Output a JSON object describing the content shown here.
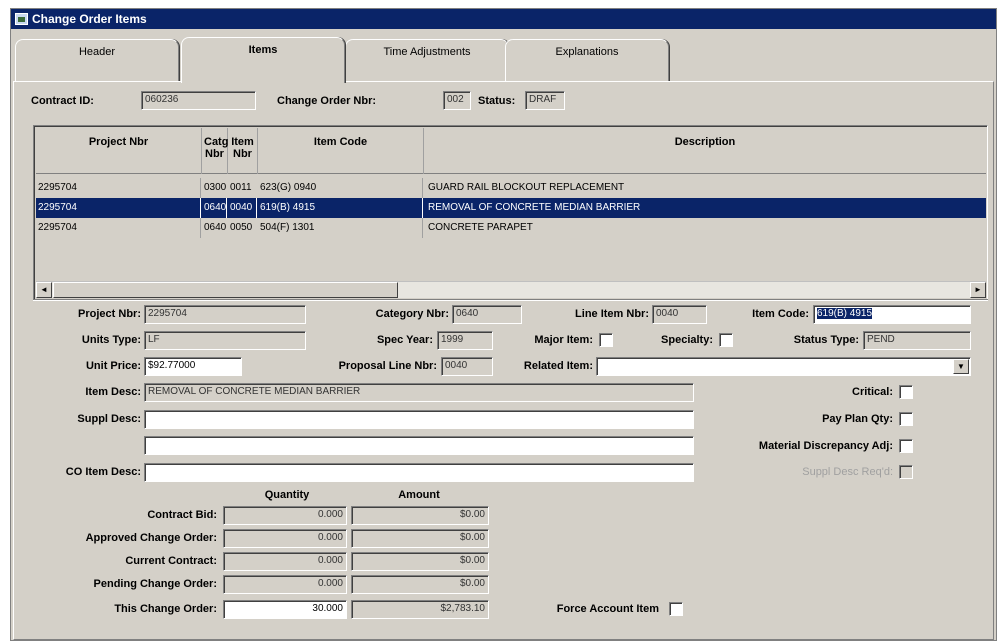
{
  "window": {
    "title": "Change Order Items"
  },
  "tabs": [
    {
      "label": "Header"
    },
    {
      "label": "Items"
    },
    {
      "label": "Time Adjustments"
    },
    {
      "label": "Explanations"
    }
  ],
  "header_info": {
    "contract_id_label": "Contract ID:",
    "contract_id": "060236",
    "change_order_label": "Change Order Nbr:",
    "change_order": "002",
    "status_label": "Status:",
    "status": "DRAF"
  },
  "grid": {
    "columns": {
      "project": "Project Nbr",
      "catg": "Catg Nbr",
      "item": "Item Nbr",
      "code": "Item Code",
      "desc": "Description"
    },
    "rows": [
      {
        "project": "2295704",
        "catg": "0300",
        "item": "0011",
        "code": "623(G) 0940",
        "desc": "GUARD RAIL BLOCKOUT REPLACEMENT"
      },
      {
        "project": "2295704",
        "catg": "0640",
        "item": "0040",
        "code": "619(B) 4915",
        "desc": "REMOVAL OF CONCRETE MEDIAN BARRIER"
      },
      {
        "project": "2295704",
        "catg": "0640",
        "item": "0050",
        "code": "504(F) 1301",
        "desc": "CONCRETE PARAPET"
      }
    ]
  },
  "detail": {
    "project_label": "Project Nbr:",
    "project": "2295704",
    "category_label": "Category Nbr:",
    "category": "0640",
    "line_item_label": "Line Item Nbr:",
    "line_item": "0040",
    "item_code_label": "Item Code:",
    "item_code": "619(B) 4915",
    "units_label": "Units Type:",
    "units": "LF",
    "spec_year_label": "Spec Year:",
    "spec_year": "1999",
    "major_label": "Major Item:",
    "specialty_label": "Specialty:",
    "status_type_label": "Status Type:",
    "status_type": "PEND",
    "unit_price_label": "Unit Price:",
    "unit_price": "$92.77000",
    "proposal_label": "Proposal Line Nbr:",
    "proposal": "0040",
    "related_label": "Related Item:",
    "related": "",
    "item_desc_label": "Item Desc:",
    "item_desc": "REMOVAL OF CONCRETE MEDIAN BARRIER",
    "suppl_desc_label": "Suppl Desc:",
    "suppl_desc_1": "",
    "suppl_desc_2": "",
    "co_desc_label": "CO Item Desc:",
    "co_desc": "",
    "critical_label": "Critical:",
    "pay_plan_label": "Pay Plan Qty:",
    "material_label": "Material Discrepancy Adj:",
    "suppl_req_label": "Suppl Desc Req'd:"
  },
  "amounts": {
    "qty_header": "Quantity",
    "amt_header": "Amount",
    "rows": [
      {
        "label": "Contract Bid:",
        "qty": "0.000",
        "amt": "$0.00"
      },
      {
        "label": "Approved Change Order:",
        "qty": "0.000",
        "amt": "$0.00"
      },
      {
        "label": "Current Contract:",
        "qty": "0.000",
        "amt": "$0.00"
      },
      {
        "label": "Pending Change Order:",
        "qty": "0.000",
        "amt": "$0.00"
      },
      {
        "label": "This Change Order:",
        "qty": "30.000",
        "amt": "$2,783.10"
      }
    ],
    "force_account_label": "Force Account Item"
  },
  "icons": {
    "app": "window-app-icon",
    "scroll_left": "scroll-left-arrow-icon",
    "scroll_right": "scroll-right-arrow-icon",
    "dropdown": "dropdown-arrow-icon"
  },
  "colors": {
    "title_bar": "#0a2468",
    "selection": "#0a2468",
    "face": "#d4d0c8"
  }
}
